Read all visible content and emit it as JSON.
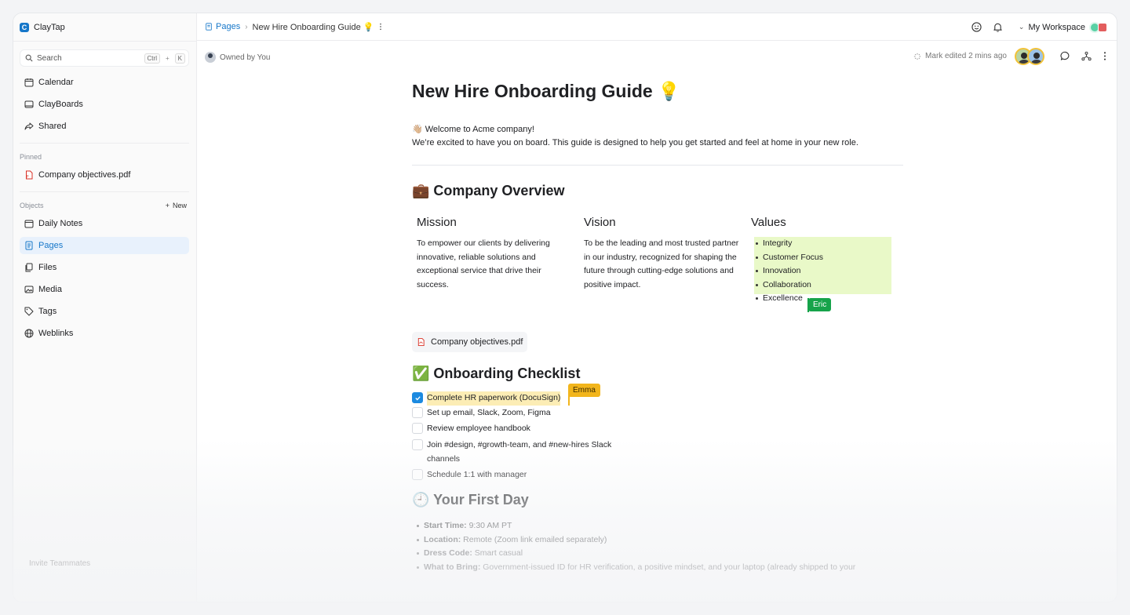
{
  "app": {
    "name": "ClayTap",
    "logo_letter": "C"
  },
  "search": {
    "label": "Search",
    "shortcut_key1": "Ctrl",
    "shortcut_plus": "+",
    "shortcut_key2": "K"
  },
  "sidebar": {
    "top_items": [
      {
        "label": "Calendar",
        "icon": "calendar-icon"
      },
      {
        "label": "ClayBoards",
        "icon": "board-icon"
      },
      {
        "label": "Shared",
        "icon": "share-icon"
      }
    ],
    "pinned_label": "Pinned",
    "pinned_items": [
      {
        "label": "Company objectives.pdf",
        "icon": "pdf-icon"
      }
    ],
    "objects_label": "Objects",
    "new_label": "New",
    "object_items": [
      {
        "label": "Daily Notes",
        "icon": "calendar-icon"
      },
      {
        "label": "Pages",
        "icon": "page-icon",
        "active": true
      },
      {
        "label": "Files",
        "icon": "files-icon"
      },
      {
        "label": "Media",
        "icon": "media-icon"
      },
      {
        "label": "Tags",
        "icon": "tag-icon"
      },
      {
        "label": "Weblinks",
        "icon": "globe-icon"
      }
    ],
    "footer": "Invite Teammates"
  },
  "breadcrumb": {
    "section": "Pages",
    "title": "New Hire Onboarding Guide 💡"
  },
  "workspace": {
    "label": "My Workspace"
  },
  "meta": {
    "owner": "Owned by You",
    "edited": "Mark edited 2 mins ago"
  },
  "doc": {
    "title": "New Hire Onboarding Guide 💡",
    "intro_line1": "👋🏼 Welcome to Acme company!",
    "intro_line2": "We’re excited to have you on board. This guide is designed to help you get started and feel at home in your new role.",
    "overview_heading": "💼 Company Overview",
    "mission": {
      "heading": "Mission",
      "text": "To empower our clients by delivering innovative, reliable solutions and exceptional service that drive their success."
    },
    "vision": {
      "heading": "Vision",
      "text": "To be the leading and most trusted partner in our industry, recognized for shaping the future through cutting-edge solutions and positive impact."
    },
    "values": {
      "heading": "Values",
      "items": [
        "Integrity",
        "Customer Focus",
        "Innovation",
        "Collaboration",
        "Excellence"
      ]
    },
    "attachment": "Company objectives.pdf",
    "checklist_heading": "✅ Onboarding Checklist",
    "checklist": [
      {
        "label": "Complete HR paperwork (DocuSign)",
        "checked": true
      },
      {
        "label": "Set up email, Slack, Zoom, Figma",
        "checked": false
      },
      {
        "label": "Review employee handbook",
        "checked": false
      },
      {
        "label": "Join #design, #growth-team, and #new-hires Slack channels",
        "checked": false
      },
      {
        "label": "Schedule 1:1 with manager",
        "checked": false
      }
    ],
    "first_day_heading": "🕘 Your First Day",
    "first_day": [
      {
        "key": "Start Time:",
        "value": " 9:30 AM PT"
      },
      {
        "key": "Location:",
        "value": " Remote (Zoom link emailed separately)"
      },
      {
        "key": "Dress Code:",
        "value": " Smart casual"
      },
      {
        "key": "What to Bring:",
        "value": " Government-issued ID for HR verification, a positive mindset, and your laptop (already shipped to your"
      }
    ]
  },
  "collaborators": {
    "eric": {
      "name": "Eric",
      "color": "#16a34a"
    },
    "emma": {
      "name": "Emma",
      "color": "#f2b51c"
    }
  },
  "colors": {
    "accent": "#1677c9",
    "values_highlight": "#e9f9c8",
    "emma_highlight": "#fcedb5"
  }
}
